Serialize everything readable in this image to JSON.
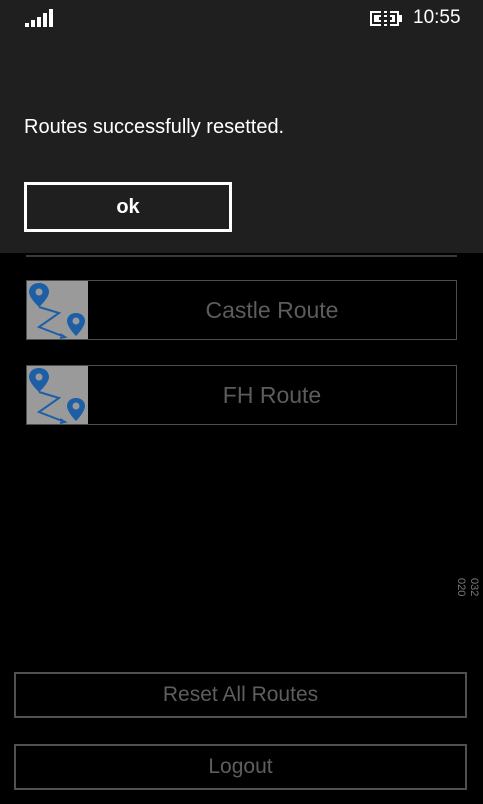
{
  "status_bar": {
    "time": "10:55",
    "signal_icon": "signal-bars-icon",
    "battery_icon": "battery-charging-icon"
  },
  "dialog": {
    "message": "Routes successfully resetted.",
    "ok_label": "ok"
  },
  "routes": [
    {
      "label": "Castle Route",
      "icon": "route-map-icon"
    },
    {
      "label": "FH Route",
      "icon": "route-map-icon"
    }
  ],
  "version": {
    "line1": "032",
    "line2": "020"
  },
  "actions": {
    "reset_label": "Reset All Routes",
    "logout_label": "Logout"
  },
  "colors": {
    "dialog_bg": "#1f1f1f",
    "route_icon_blue": "#1d5fa6",
    "thumb_bg": "#9a9a9a"
  }
}
